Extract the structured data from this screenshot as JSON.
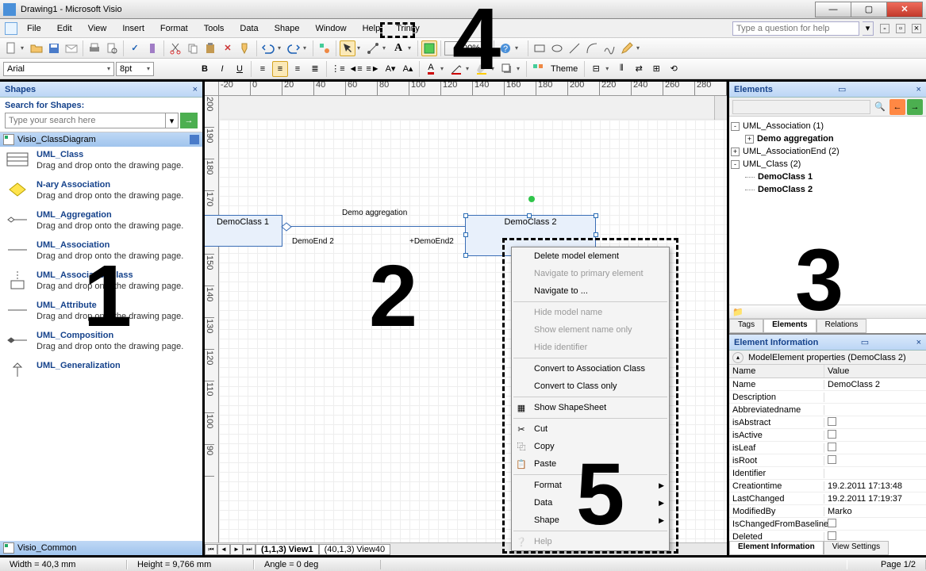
{
  "title": "Drawing1 - Microsoft Visio",
  "menus": [
    "File",
    "Edit",
    "View",
    "Insert",
    "Format",
    "Tools",
    "Data",
    "Shape",
    "Window",
    "Help",
    "Trinity"
  ],
  "help_placeholder": "Type a question for help",
  "font": "Arial",
  "fontsize": "8pt",
  "zoom": "100%",
  "theme_label": "Theme",
  "shapes_panel": {
    "title": "Shapes",
    "search_label": "Search for Shapes:",
    "search_placeholder": "Type your search here",
    "stencil1": "Visio_ClassDiagram",
    "stencil2": "Visio_Common",
    "items": [
      {
        "name": "UML_Class",
        "desc": "Drag and drop onto the drawing page."
      },
      {
        "name": "N-ary Association",
        "desc": "Drag and drop onto the drawing page."
      },
      {
        "name": "UML_Aggregation",
        "desc": "Drag and drop onto the drawing page."
      },
      {
        "name": "UML_Association",
        "desc": "Drag and drop onto the drawing page."
      },
      {
        "name": "UML_AssociationClass",
        "desc": "Drag and drop onto the drawing page."
      },
      {
        "name": "UML_Attribute",
        "desc": "Drag and drop onto the drawing page."
      },
      {
        "name": "UML_Composition",
        "desc": "Drag and drop onto the drawing page."
      },
      {
        "name": "UML_Generalization",
        "desc": ""
      }
    ]
  },
  "canvas": {
    "class1": "DemoClass 1",
    "class2": "DemoClass 2",
    "assoc": "Demo aggregation",
    "end1": "DemoEnd 2",
    "end2": "+DemoEnd2",
    "view1": "View1",
    "view1_prefix": "(1,1,3)",
    "view40": "View40",
    "view40_prefix": "(40,1,3)"
  },
  "context_menu": {
    "items": [
      {
        "label": "Delete model element",
        "type": "i"
      },
      {
        "label": "Navigate to primary element",
        "type": "d"
      },
      {
        "label": "Navigate to ...",
        "type": "i"
      },
      {
        "type": "sep"
      },
      {
        "label": "Hide model name",
        "type": "d"
      },
      {
        "label": "Show element name only",
        "type": "d"
      },
      {
        "label": "Hide identifier",
        "type": "d"
      },
      {
        "type": "sep"
      },
      {
        "label": "Convert to Association Class",
        "type": "i"
      },
      {
        "label": "Convert to Class only",
        "type": "i"
      },
      {
        "type": "sep"
      },
      {
        "label": "Show ShapeSheet",
        "type": "i",
        "icon": "sheet"
      },
      {
        "type": "sep"
      },
      {
        "label": "Cut",
        "type": "i",
        "icon": "cut"
      },
      {
        "label": "Copy",
        "type": "i",
        "icon": "copy"
      },
      {
        "label": "Paste",
        "type": "i",
        "icon": "paste"
      },
      {
        "type": "sep"
      },
      {
        "label": "Format",
        "type": "sub"
      },
      {
        "label": "Data",
        "type": "sub"
      },
      {
        "label": "Shape",
        "type": "sub"
      },
      {
        "type": "sep"
      },
      {
        "label": "Help",
        "type": "d",
        "icon": "help"
      }
    ]
  },
  "elements_panel": {
    "title": "Elements",
    "tree": [
      {
        "level": 0,
        "toggle": "-",
        "label": "UML_Association (1)"
      },
      {
        "level": 1,
        "toggle": "+",
        "label": "Demo aggregation",
        "bold": true
      },
      {
        "level": 0,
        "toggle": "+",
        "label": "UML_AssociationEnd (2)"
      },
      {
        "level": 0,
        "toggle": "-",
        "label": "UML_Class (2)"
      },
      {
        "level": 1,
        "label": "DemoClass 1",
        "bold": true
      },
      {
        "level": 1,
        "label": "DemoClass 2",
        "bold": true
      }
    ],
    "tabs": [
      "Tags",
      "Elements",
      "Relations"
    ]
  },
  "info_panel": {
    "title": "Element Information",
    "group": "ModelElement properties (DemoClass 2)",
    "head_name": "Name",
    "head_value": "Value",
    "rows": [
      {
        "n": "Name",
        "v": "DemoClass 2"
      },
      {
        "n": "Description",
        "v": ""
      },
      {
        "n": "Abbreviatedname",
        "v": ""
      },
      {
        "n": "isAbstract",
        "v": "",
        "chk": true
      },
      {
        "n": "isActive",
        "v": "",
        "chk": true
      },
      {
        "n": "isLeaf",
        "v": "",
        "chk": true
      },
      {
        "n": "isRoot",
        "v": "",
        "chk": true
      },
      {
        "n": "Identifier",
        "v": ""
      },
      {
        "n": "Creationtime",
        "v": "19.2.2011 17:13:48"
      },
      {
        "n": "LastChanged",
        "v": "19.2.2011 17:19:37"
      },
      {
        "n": "ModifiedBy",
        "v": "Marko"
      },
      {
        "n": "IsChangedFromBaseline",
        "v": "",
        "chk": true
      },
      {
        "n": "Deleted",
        "v": "",
        "chk": true
      }
    ],
    "bottom_tabs": [
      "Element Information",
      "View Settings"
    ]
  },
  "status": {
    "width": "Width = 40,3 mm",
    "height": "Height = 9,766 mm",
    "angle": "Angle = 0 deg",
    "page": "Page 1/2"
  },
  "overlay": {
    "n1": "1",
    "n2": "2",
    "n3": "3",
    "n4": "4",
    "n5": "5"
  }
}
